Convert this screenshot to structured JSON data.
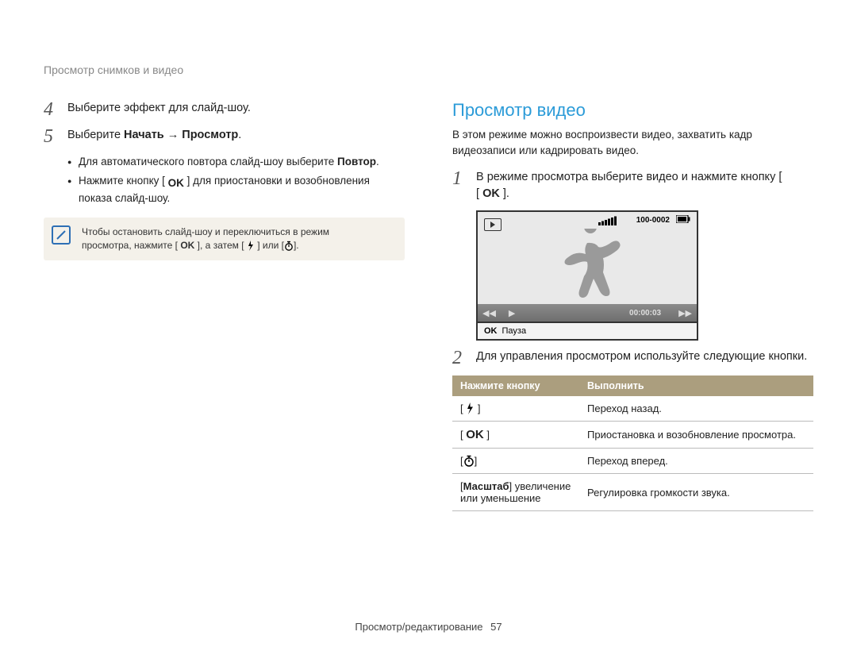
{
  "breadcrumb": "Просмотр снимков и видео",
  "left": {
    "step4": {
      "num": "4",
      "text": "Выберите эффект для слайд-шоу."
    },
    "step5": {
      "num": "5",
      "prefix": "Выберите ",
      "bold": "Начать → Просмотр",
      "suffix": "."
    },
    "bullets": [
      {
        "pre": "Для автоматического повтора слайд-шоу выберите ",
        "bold": "Повтор",
        "suf": "."
      },
      {
        "pre": "Нажмите кнопку [ ",
        "mid": " ] для приостановки и возобновления показа слайд-шоу."
      }
    ],
    "note": {
      "line1": "Чтобы остановить слайд-шоу и переключиться в режим",
      "line2_a": "просмотра, нажмите [ ",
      "line2_b": " ], а затем [ ",
      "line2_c": " ] или [",
      "line2_d": "]."
    }
  },
  "right": {
    "heading": "Просмотр видео",
    "intro": "В этом режиме можно воспроизвести видео, захватить кадр видеозаписи или кадрировать видео.",
    "step1": {
      "num": "1",
      "pre": "В режиме просмотра выберите видео и нажмите кнопку [ ",
      "suf": " ]."
    },
    "video": {
      "counter": "100-0002",
      "time": "00:00:03",
      "pause": "Пауза"
    },
    "step2": {
      "num": "2",
      "text": "Для управления просмотром используйте следующие кнопки."
    },
    "table": {
      "h1": "Нажмите кнопку",
      "h2": "Выполнить",
      "rows": [
        {
          "k": "flash",
          "v": "Переход назад."
        },
        {
          "k": "ok",
          "v": "Приостановка и возобновление просмотра."
        },
        {
          "k": "timer",
          "v": "Переход вперед."
        },
        {
          "k_text_pre": "[",
          "k_bold": "Масштаб",
          "k_text_suf": "] увеличение или уменьшение",
          "v": "Регулировка громкости звука."
        }
      ]
    }
  },
  "footer": {
    "label": "Просмотр/редактирование",
    "page": "57"
  }
}
